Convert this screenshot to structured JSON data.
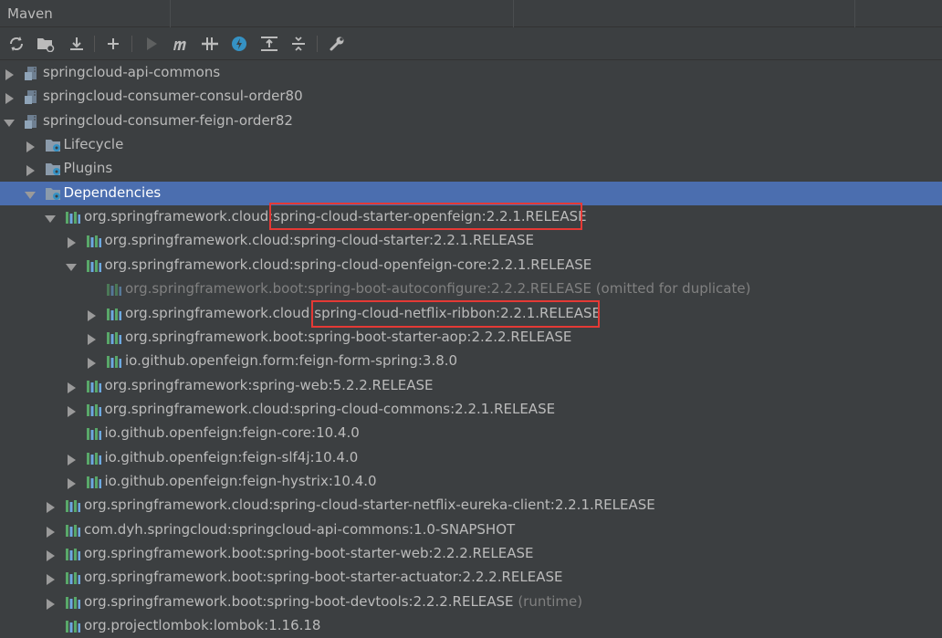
{
  "panel": {
    "title": "Maven"
  },
  "toolbar": {
    "buttons": [
      {
        "name": "reload-icon"
      },
      {
        "name": "add-maven-projects-icon"
      },
      {
        "name": "download-sources-icon"
      },
      {
        "name": "plus-icon"
      },
      {
        "name": "run-icon"
      },
      {
        "name": "execute-goal-icon"
      },
      {
        "name": "toggle-offline-icon"
      },
      {
        "name": "skip-tests-icon"
      },
      {
        "name": "show-dependencies-icon"
      },
      {
        "name": "collapse-all-icon"
      },
      {
        "name": "settings-icon"
      }
    ]
  },
  "tree": {
    "rows": [
      {
        "label": "springcloud-api-commons"
      },
      {
        "label": "springcloud-consumer-consul-order80"
      },
      {
        "label": "springcloud-consumer-feign-order82"
      },
      {
        "label": "Lifecycle"
      },
      {
        "label": "Plugins"
      },
      {
        "label": "Dependencies"
      },
      {
        "prefix": "org.springframework.cloud:",
        "label": "spring-cloud-starter-openfeign:2.2.1.RELEASE"
      },
      {
        "label": "org.springframework.cloud:spring-cloud-starter:2.2.1.RELEASE"
      },
      {
        "label": "org.springframework.cloud:spring-cloud-openfeign-core:2.2.1.RELEASE"
      },
      {
        "label": "org.springframework.boot:spring-boot-autoconfigure:2.2.2.RELEASE (omitted for duplicate)"
      },
      {
        "prefix": "org.springframework.cloud:",
        "label": "spring-cloud-netflix-ribbon:2.2.1.RELEASE"
      },
      {
        "label": "org.springframework.boot:spring-boot-starter-aop:2.2.2.RELEASE"
      },
      {
        "label": "io.github.openfeign.form:feign-form-spring:3.8.0"
      },
      {
        "label": "org.springframework:spring-web:5.2.2.RELEASE"
      },
      {
        "label": "org.springframework.cloud:spring-cloud-commons:2.2.1.RELEASE"
      },
      {
        "label": "io.github.openfeign:feign-core:10.4.0"
      },
      {
        "label": "io.github.openfeign:feign-slf4j:10.4.0"
      },
      {
        "label": "io.github.openfeign:feign-hystrix:10.4.0"
      },
      {
        "label": "org.springframework.cloud:spring-cloud-starter-netflix-eureka-client:2.2.1.RELEASE"
      },
      {
        "label": "com.dyh.springcloud:springcloud-api-commons:1.0-SNAPSHOT"
      },
      {
        "label": "org.springframework.boot:spring-boot-starter-web:2.2.2.RELEASE"
      },
      {
        "label": "org.springframework.boot:spring-boot-starter-actuator:2.2.2.RELEASE"
      },
      {
        "label": "org.springframework.boot:spring-boot-devtools:2.2.2.RELEASE",
        "suffix": "(runtime)"
      },
      {
        "label": "org.projectlombok:lombok:1.16.18"
      }
    ]
  },
  "colors": {
    "background": "#3c3f41",
    "selection": "#4b6eaf",
    "highlight_box": "#e53935",
    "text": "#bbbbbb",
    "muted_text": "#808080"
  }
}
